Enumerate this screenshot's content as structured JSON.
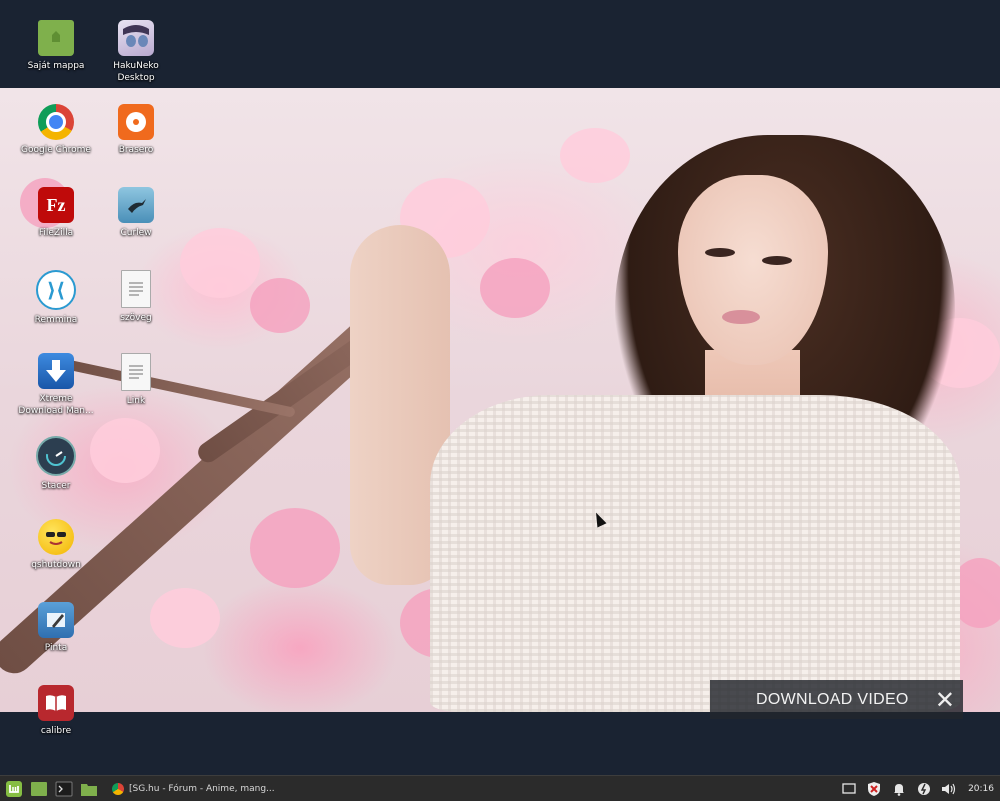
{
  "desktop": {
    "top_icons": [
      {
        "label": "Saját mappa",
        "icon": "folder-icon"
      },
      {
        "label": "HakuNeko\nDesktop",
        "icon": "hakuneko-icon"
      }
    ],
    "left_icons": [
      {
        "label": "Google Chrome",
        "icon": "chrome-icon"
      },
      {
        "label": "Brasero",
        "icon": "brasero-icon"
      },
      {
        "label": "FileZilla",
        "icon": "filezilla-icon"
      },
      {
        "label": "Curlew",
        "icon": "curlew-icon"
      },
      {
        "label": "Remmina",
        "icon": "remmina-icon"
      },
      {
        "label": "szöveg",
        "icon": "text-file-icon"
      },
      {
        "label": "Xtreme\nDownload Man...",
        "icon": "xdm-icon"
      },
      {
        "label": "Link",
        "icon": "text-file-icon"
      },
      {
        "label": "Stacer",
        "icon": "stacer-icon"
      },
      {
        "label": "qshutdown",
        "icon": "qshutdown-icon"
      },
      {
        "label": "Pinta",
        "icon": "pinta-icon"
      },
      {
        "label": "calibre",
        "icon": "calibre-icon"
      }
    ]
  },
  "overlay": {
    "download_label": "DOWNLOAD VIDEO",
    "close_glyph": "✕"
  },
  "taskbar": {
    "window_title": "[SG.hu - Fórum - Anime, mang...",
    "clock": "20:16"
  }
}
